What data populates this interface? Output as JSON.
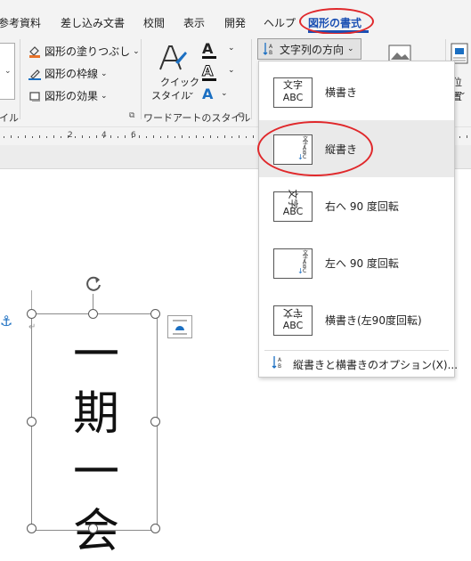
{
  "tabs": [
    {
      "label": "参考資料"
    },
    {
      "label": "差し込み文書"
    },
    {
      "label": "校閲"
    },
    {
      "label": "表示"
    },
    {
      "label": "開発"
    },
    {
      "label": "ヘルプ"
    },
    {
      "label": "図形の書式"
    }
  ],
  "ribbon": {
    "shape_fill": "図形の塗りつぶし",
    "shape_outline": "図形の枠線",
    "shape_effects": "図形の効果",
    "quick_style_line1": "クイック",
    "quick_style_line2": "スタイル",
    "text_direction": "文字列の方向",
    "position": "位置",
    "group_shape_styles": "イル",
    "group_wordart_styles": "ワードアートのスタイル"
  },
  "ruler": {
    "numbers": [
      "2",
      "4",
      "6"
    ]
  },
  "dropdown": {
    "items": [
      {
        "label": "横書き",
        "icon_top": "文字",
        "icon_bottom": "ABC"
      },
      {
        "label": "縦書き",
        "icon_text": "文字ABC"
      },
      {
        "label": "右へ 90 度回転",
        "icon_top": "文字",
        "icon_bottom": "ABC"
      },
      {
        "label": "左へ 90 度回転",
        "icon_text": "文字ABC"
      },
      {
        "label": "横書き(左90度回転)",
        "icon_top": "文字",
        "icon_bottom": "ABC"
      }
    ],
    "options_label": "縦書きと横書きのオプション(X)..."
  },
  "document": {
    "text_chars": [
      "一",
      "期",
      "一",
      "会"
    ]
  },
  "colors": {
    "accent": "#1a4fb3",
    "highlight": "#e0282b",
    "anchor": "#1b6fc2"
  }
}
